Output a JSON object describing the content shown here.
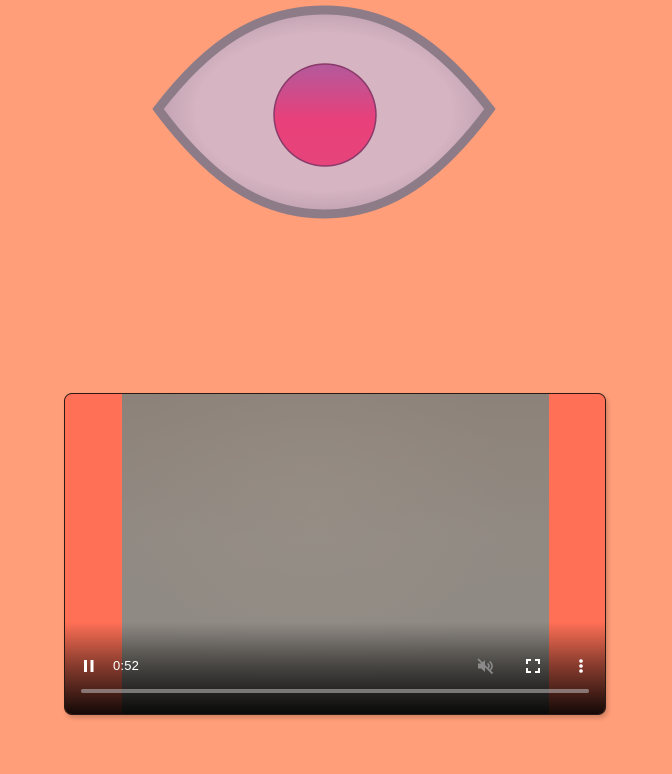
{
  "colors": {
    "background": "#ff9e78",
    "eye_white": "#d4b4c0",
    "eye_outline": "#8c7a86",
    "iris_top": "#b8579e",
    "iris_bottom": "#e9417a",
    "letterbox": "#ff7056"
  },
  "eye": {
    "icon": "eye-icon"
  },
  "video": {
    "time": "0:52",
    "progress": 0,
    "state": "playing",
    "muted": true,
    "icons": {
      "play_pause": "pause-icon",
      "mute": "volume-muted-icon",
      "fullscreen": "fullscreen-icon",
      "more": "more-vert-icon"
    }
  }
}
